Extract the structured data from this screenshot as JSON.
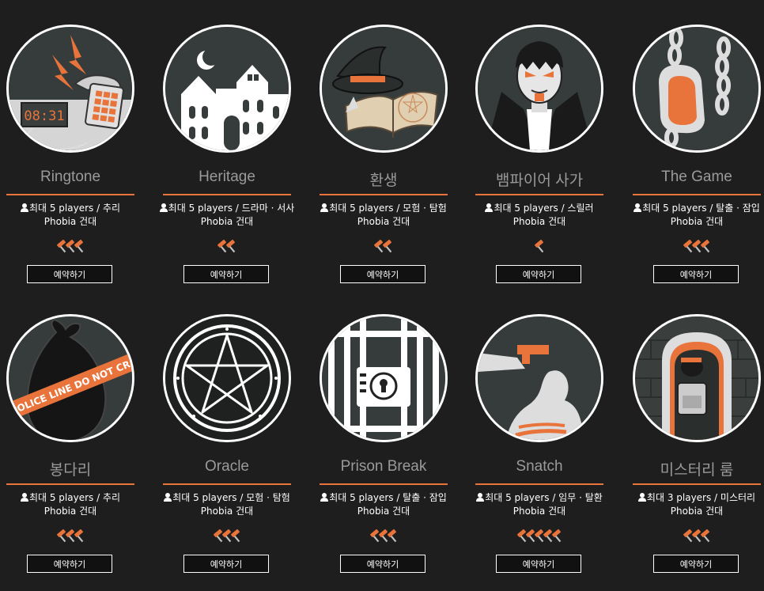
{
  "themes": [
    {
      "title": "Ringtone",
      "players": "최대 5 players / 추리",
      "venue": "Phobia 건대",
      "difficulty": 3,
      "button": "예약하기",
      "art": "ringtone-art",
      "clock": "08:31"
    },
    {
      "title": "Heritage",
      "players": "최대 5 players / 드라마 · 서사",
      "venue": "Phobia 건대",
      "difficulty": 2,
      "button": "예약하기",
      "art": "heritage-art"
    },
    {
      "title": "환생",
      "players": "최대 5 players / 모험 · 탐험",
      "venue": "Phobia 건대",
      "difficulty": 2,
      "button": "예약하기",
      "art": "rebirth-art"
    },
    {
      "title": "뱀파이어 사가",
      "players": "최대 5 players / 스릴러",
      "venue": "Phobia 건대",
      "difficulty": 1,
      "button": "예약하기",
      "art": "vampire-art"
    },
    {
      "title": "The Game",
      "players": "최대 5 players / 탈출 · 잠입",
      "venue": "Phobia 건대",
      "difficulty": 3,
      "button": "예약하기",
      "art": "the-game-art"
    },
    {
      "title": "봉다리",
      "players": "최대 5 players / 추리",
      "venue": "Phobia 건대",
      "difficulty": 3,
      "button": "예약하기",
      "art": "bongdari-art",
      "tape": "POLICE LINE DO NOT CR"
    },
    {
      "title": "Oracle",
      "players": "최대 5 players / 모험 · 탐험",
      "venue": "Phobia 건대",
      "difficulty": 3,
      "button": "예약하기",
      "art": "oracle-art"
    },
    {
      "title": "Prison Break",
      "players": "최대 5 players / 탈출 · 잠입",
      "venue": "Phobia 건대",
      "difficulty": 3,
      "button": "예약하기",
      "art": "prison-break-art"
    },
    {
      "title": "Snatch",
      "players": "최대 5 players / 임무 · 탈환",
      "venue": "Phobia 건대",
      "difficulty": 5,
      "button": "예약하기",
      "art": "snatch-art"
    },
    {
      "title": "미스터리 룸",
      "players": "최대 3 players / 미스터리",
      "venue": "Phobia 건대",
      "difficulty": 3,
      "button": "예약하기",
      "art": "mystery-room-art"
    }
  ],
  "colors": {
    "accent": "#e8743b",
    "background": "#1e1e1f",
    "art_bg": "#363c3b",
    "title_text": "#9a9a9a"
  },
  "icons": {
    "players": "person-icon",
    "difficulty": "hammer-icon"
  }
}
